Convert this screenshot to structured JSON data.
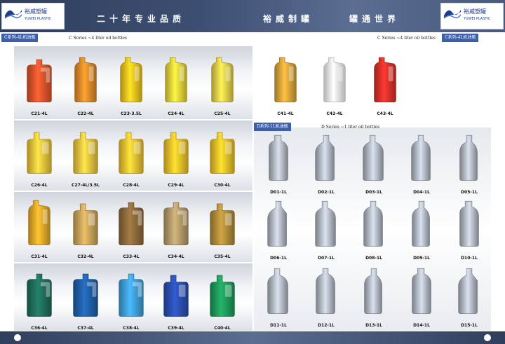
{
  "header": {
    "slogan_left": "二十年专业品质",
    "slogan_mid": "裕威制罐",
    "slogan_right": "罐通世界",
    "logo_cn": "裕威塑罐",
    "logo_en": "YUWEI PLASTIC"
  },
  "tabs": {
    "c_left": "C系列-4L机油瓶",
    "c_left_en": "C Series ~4 liter oil bottles",
    "c_right": "C系列-4L机油瓶",
    "c_right_en": "C Series ~4 liter oil bottles",
    "d": "D系列-1L机油瓶",
    "d_en": "D Series ~1 liter oil bottles"
  },
  "colors": {
    "brand": "#3d5fa8",
    "bar": "#2f3e5c"
  },
  "rows": [
    [
      {
        "label": "C21-4L",
        "color": "#e0542a",
        "shape": "jug"
      },
      {
        "label": "C22-4L",
        "color": "#e08a2a",
        "shape": "tall"
      },
      {
        "label": "C23-3.5L",
        "color": "#f2c31e",
        "shape": "tall"
      },
      {
        "label": "C24-4L",
        "color": "#e8d23a",
        "shape": "tall"
      },
      {
        "label": "C25-4L",
        "color": "#e8cf4a",
        "shape": "tall"
      }
    ],
    [
      {
        "label": "C26-4L",
        "color": "#f0c43c",
        "shape": "flat"
      },
      {
        "label": "C27-4L/3.5L",
        "color": "#efc440",
        "shape": "flat"
      },
      {
        "label": "C28-4L",
        "color": "#f2c232",
        "shape": "flat"
      },
      {
        "label": "C29-4L",
        "color": "#f0c028",
        "shape": "flat"
      },
      {
        "label": "C30-4L",
        "color": "#eec028",
        "shape": "flat"
      }
    ],
    [
      {
        "label": "C31-4L",
        "color": "#e6a82a",
        "shape": "tall"
      },
      {
        "label": "C32-4L",
        "color": "#c9a35a",
        "shape": "flat"
      },
      {
        "label": "C33-4L",
        "color": "#8d6a3a",
        "shape": "jug"
      },
      {
        "label": "C34-4L",
        "color": "#b49a6a",
        "shape": "jug"
      },
      {
        "label": "C35-4L",
        "color": "#b08c3a",
        "shape": "flat"
      }
    ],
    [
      {
        "label": "C36-4L",
        "color": "#1f6e5a",
        "shape": "jug"
      },
      {
        "label": "C37-4L",
        "color": "#1f5fa8",
        "shape": "jug"
      },
      {
        "label": "C38-4L",
        "color": "#3f9fd8",
        "shape": "jug"
      },
      {
        "label": "C39-4L",
        "color": "#2a4fb0",
        "shape": "flat"
      },
      {
        "label": "C40-4L",
        "color": "#1f9a5a",
        "shape": "flat"
      }
    ]
  ],
  "c_right_row": [
    {
      "label": "C41-4L",
      "color": "#d8a43a",
      "shape": "tall"
    },
    {
      "label": "C42-4L",
      "color": "#f4f6f8",
      "shape": "tall"
    },
    {
      "label": "C43-4L",
      "color": "#d8302a",
      "shape": "tall"
    }
  ],
  "d_rows": [
    [
      {
        "label": "D01-1L"
      },
      {
        "label": "D02-1L"
      },
      {
        "label": "D03-1L"
      },
      {
        "label": "D04-1L"
      },
      {
        "label": "D05-1L"
      }
    ],
    [
      {
        "label": "D06-1L"
      },
      {
        "label": "D07-1L"
      },
      {
        "label": "D08-1L"
      },
      {
        "label": "D09-1L"
      },
      {
        "label": "D10-1L"
      }
    ],
    [
      {
        "label": "D11-1L"
      },
      {
        "label": "D12-1L"
      },
      {
        "label": "D13-1L"
      },
      {
        "label": "D14-1L"
      },
      {
        "label": "D15-1L"
      }
    ]
  ],
  "d_color": "#aeb5c0"
}
